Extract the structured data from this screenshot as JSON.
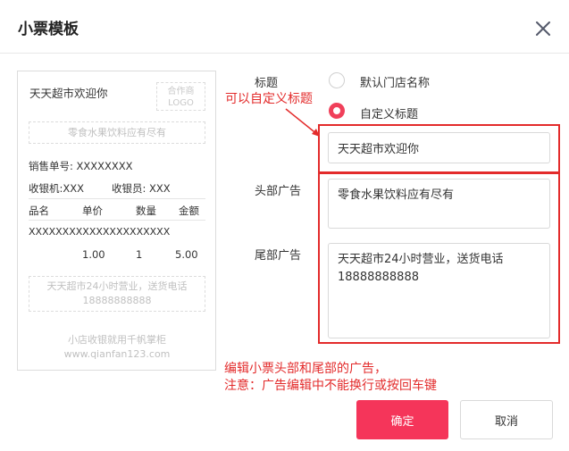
{
  "dialog": {
    "title": "小票模板"
  },
  "receipt": {
    "title": "天天超市欢迎你",
    "logo_line1": "合作商",
    "logo_line2": "LOGO",
    "head_ad": "零食水果饮料应有尽有",
    "order_no": "销售单号: XXXXXXXX",
    "cashier_machine": "收银机:XXX",
    "cashier": "收银员: XXX",
    "columns": [
      "品名",
      "单价",
      "数量",
      "金额"
    ],
    "item_name": "XXXXXXXXXXXXXXXXXXXXX",
    "item_values": [
      "1.00",
      "1",
      "5.00"
    ],
    "foot_ad_line1": "天天超市24小时营业，送货电话",
    "foot_ad_line2": "18888888888",
    "brand_line1": "小店收银就用千帆掌柜",
    "brand_line2": "www.qianfan123.com"
  },
  "form": {
    "title_label": "标题",
    "option_default": "默认门店名称",
    "option_custom": "自定义标题",
    "selected_option": "自定义标题",
    "title_value": "天天超市欢迎你",
    "head_label": "头部广告",
    "head_value": "零食水果饮料应有尽有",
    "foot_label": "尾部广告",
    "foot_value": "天天超市24小时营业，送货电话\n18888888888"
  },
  "annotations": {
    "custom_title": "可以自定义标题",
    "edit_line1": "编辑小票头部和尾部的广告，",
    "edit_line2": "注意：广告编辑中不能换行或按回车键"
  },
  "buttons": {
    "ok": "确定",
    "cancel": "取消"
  },
  "colors": {
    "accent": "#f5355a",
    "annotation": "#e32b2b"
  }
}
